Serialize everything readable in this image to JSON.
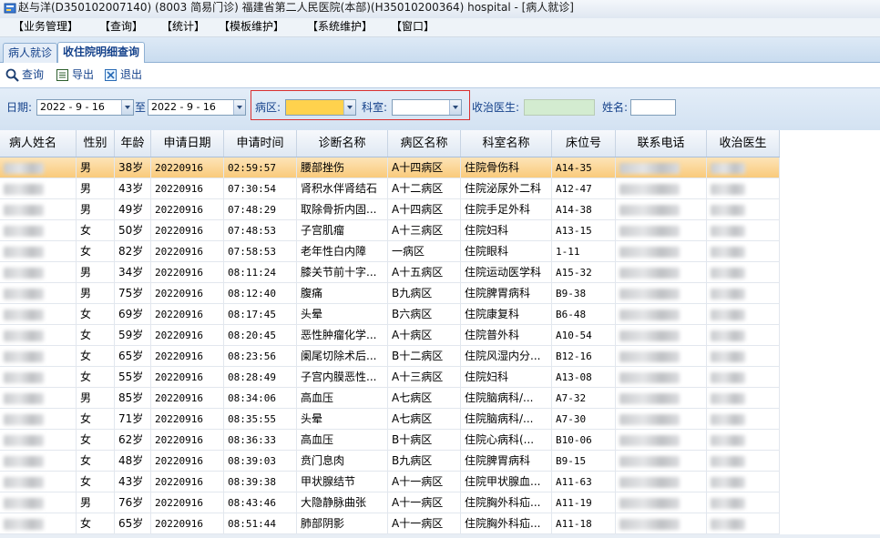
{
  "window": {
    "title": "赵与洋(D350102007140) (8003 简易门诊) 福建省第二人民医院(本部)(H35010200364) hospital - [病人就诊]"
  },
  "menu": [
    "【业务管理】",
    "【查询】",
    "【统计】",
    "【模板维护】",
    "【系统维护】",
    "【窗口】"
  ],
  "tabs": [
    {
      "label": "病人就诊",
      "active": false
    },
    {
      "label": "收住院明细查询",
      "active": true
    }
  ],
  "toolbar": {
    "query": "查询",
    "export": "导出",
    "exit": "退出"
  },
  "filters": {
    "date_label": "日期:",
    "date_from": "2022 - 9 - 16",
    "to_label": "至",
    "date_to": "2022 - 9 - 16",
    "ward_label": "病区:",
    "ward_value": "",
    "dept_label": "科室:",
    "dept_value": "",
    "doctor_label": "收治医生:",
    "doctor_value": "",
    "name_label": "姓名:",
    "name_value": ""
  },
  "colors": {
    "selected_row": "#f9c978",
    "ward_field": "#ffd24d",
    "doctor_field": "#d3ecd0",
    "highlight_box": "#d93030"
  },
  "table": {
    "columns": [
      "病人姓名",
      "性别",
      "年龄",
      "申请日期",
      "申请时间",
      "诊断名称",
      "病区名称",
      "科室名称",
      "床位号",
      "联系电话",
      "收治医生"
    ],
    "rows": [
      [
        "",
        "男",
        "38岁",
        "20220916",
        "02:59:57",
        "腰部挫伤",
        "A十四病区",
        "住院骨伤科",
        "A14-35",
        "",
        ""
      ],
      [
        "",
        "男",
        "43岁",
        "20220916",
        "07:30:54",
        "肾积水伴肾结石",
        "A十二病区",
        "住院泌尿外二科",
        "A12-47",
        "",
        ""
      ],
      [
        "",
        "男",
        "49岁",
        "20220916",
        "07:48:29",
        "取除骨折内固...",
        "A十四病区",
        "住院手足外科",
        "A14-38",
        "",
        ""
      ],
      [
        "",
        "女",
        "50岁",
        "20220916",
        "07:48:53",
        "子宫肌瘤",
        "A十三病区",
        "住院妇科",
        "A13-15",
        "",
        ""
      ],
      [
        "",
        "女",
        "82岁",
        "20220916",
        "07:58:53",
        "老年性白内障",
        "一病区",
        "住院眼科",
        "1-11",
        "",
        ""
      ],
      [
        "",
        "男",
        "34岁",
        "20220916",
        "08:11:24",
        "膝关节前十字...",
        "A十五病区",
        "住院运动医学科",
        "A15-32",
        "",
        ""
      ],
      [
        "",
        "男",
        "75岁",
        "20220916",
        "08:12:40",
        "腹痛",
        "B九病区",
        "住院脾胃病科",
        "B9-38",
        "",
        ""
      ],
      [
        "",
        "女",
        "69岁",
        "20220916",
        "08:17:45",
        "头晕",
        "B六病区",
        "住院康复科",
        "B6-48",
        "",
        ""
      ],
      [
        "",
        "女",
        "59岁",
        "20220916",
        "08:20:45",
        "恶性肿瘤化学...",
        "A十病区",
        "住院普外科",
        "A10-54",
        "",
        ""
      ],
      [
        "",
        "女",
        "65岁",
        "20220916",
        "08:23:56",
        "阑尾切除术后...",
        "B十二病区",
        "住院风湿内分...",
        "B12-16",
        "",
        ""
      ],
      [
        "",
        "女",
        "55岁",
        "20220916",
        "08:28:49",
        "子宫内膜恶性...",
        "A十三病区",
        "住院妇科",
        "A13-08",
        "",
        ""
      ],
      [
        "",
        "男",
        "85岁",
        "20220916",
        "08:34:06",
        "高血压",
        "A七病区",
        "住院脑病科/...",
        "A7-32",
        "",
        ""
      ],
      [
        "",
        "女",
        "71岁",
        "20220916",
        "08:35:55",
        "头晕",
        "A七病区",
        "住院脑病科/...",
        "A7-30",
        "",
        ""
      ],
      [
        "",
        "女",
        "62岁",
        "20220916",
        "08:36:33",
        "高血压",
        "B十病区",
        "住院心病科(...",
        "B10-06",
        "",
        ""
      ],
      [
        "",
        "女",
        "48岁",
        "20220916",
        "08:39:03",
        "贲门息肉",
        "B九病区",
        "住院脾胃病科",
        "B9-15",
        "",
        ""
      ],
      [
        "",
        "女",
        "43岁",
        "20220916",
        "08:39:38",
        "甲状腺结节",
        "A十一病区",
        "住院甲状腺血...",
        "A11-63",
        "",
        ""
      ],
      [
        "",
        "男",
        "76岁",
        "20220916",
        "08:43:46",
        "大隐静脉曲张",
        "A十一病区",
        "住院胸外科疝...",
        "A11-19",
        "",
        ""
      ],
      [
        "",
        "女",
        "65岁",
        "20220916",
        "08:51:44",
        "肺部阴影",
        "A十一病区",
        "住院胸外科疝...",
        "A11-18",
        "",
        ""
      ]
    ]
  }
}
